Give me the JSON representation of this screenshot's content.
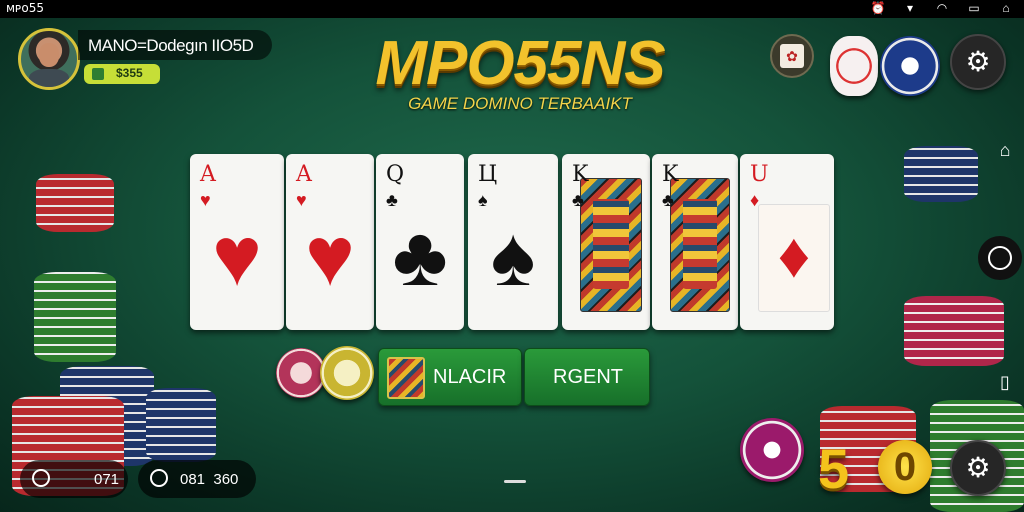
{
  "status_bar": {
    "app_label": "ᴍᴘᴏ55",
    "icons": [
      "alarm-icon",
      "wifi-icon",
      "wifi-icon",
      "battery-icon",
      "cast-icon"
    ]
  },
  "player": {
    "name": "MANO=Dodegın IIO5D",
    "coins": "$355"
  },
  "title": {
    "logo": "MPO55NS",
    "subtitle": "GAME DOMINO TERBAAIKT"
  },
  "cards": [
    {
      "rank": "A",
      "suit": "♥",
      "color": "red"
    },
    {
      "rank": "A",
      "suit": "♥",
      "color": "red"
    },
    {
      "rank": "Q",
      "suit": "♣",
      "color": "black"
    },
    {
      "rank": "Ц",
      "suit": "♠",
      "color": "black"
    },
    {
      "rank": "K",
      "suit": "♣",
      "color": "black"
    },
    {
      "rank": "K",
      "suit": "♣",
      "color": "black"
    },
    {
      "rank": "U",
      "suit": "♦",
      "color": "red"
    }
  ],
  "buttons": {
    "left_label": "NLACIR",
    "right_label": "RGENT"
  },
  "bottom": {
    "left_value": "071",
    "right_value": "081  360",
    "gold_number": "5",
    "gold_coin": "0"
  },
  "colors": {
    "felt": "#14523a",
    "gold": "#f2c22c",
    "button_green": "#2a9a3a"
  }
}
